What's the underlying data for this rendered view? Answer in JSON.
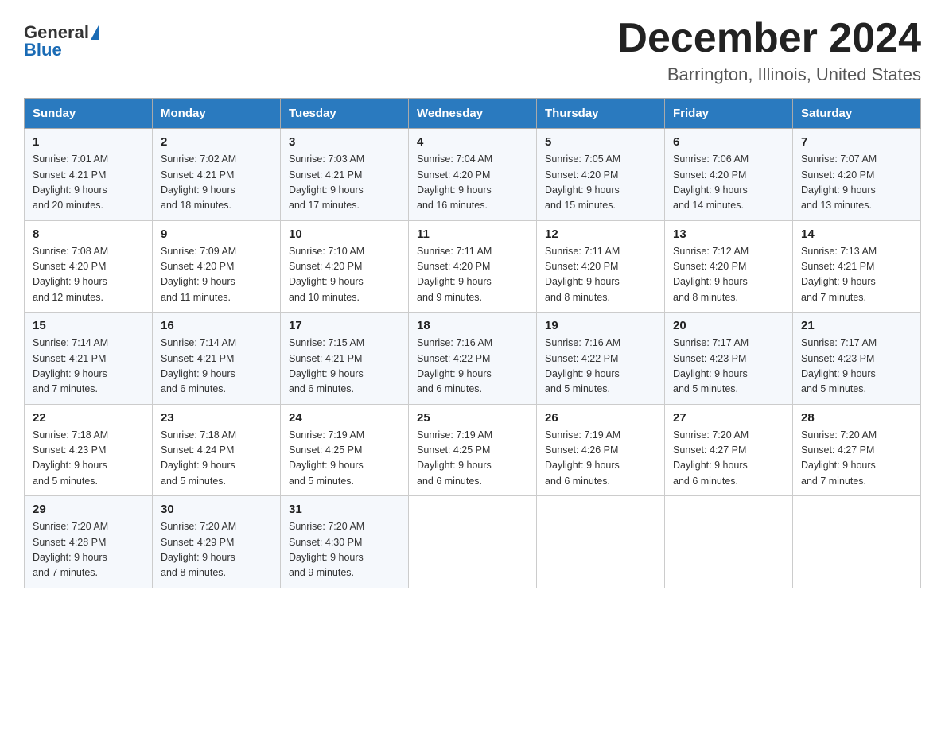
{
  "logo": {
    "general": "General",
    "blue": "Blue"
  },
  "title": "December 2024",
  "location": "Barrington, Illinois, United States",
  "days_of_week": [
    "Sunday",
    "Monday",
    "Tuesday",
    "Wednesday",
    "Thursday",
    "Friday",
    "Saturday"
  ],
  "weeks": [
    [
      {
        "day": "1",
        "sunrise": "7:01 AM",
        "sunset": "4:21 PM",
        "daylight": "9 hours and 20 minutes."
      },
      {
        "day": "2",
        "sunrise": "7:02 AM",
        "sunset": "4:21 PM",
        "daylight": "9 hours and 18 minutes."
      },
      {
        "day": "3",
        "sunrise": "7:03 AM",
        "sunset": "4:21 PM",
        "daylight": "9 hours and 17 minutes."
      },
      {
        "day": "4",
        "sunrise": "7:04 AM",
        "sunset": "4:20 PM",
        "daylight": "9 hours and 16 minutes."
      },
      {
        "day": "5",
        "sunrise": "7:05 AM",
        "sunset": "4:20 PM",
        "daylight": "9 hours and 15 minutes."
      },
      {
        "day": "6",
        "sunrise": "7:06 AM",
        "sunset": "4:20 PM",
        "daylight": "9 hours and 14 minutes."
      },
      {
        "day": "7",
        "sunrise": "7:07 AM",
        "sunset": "4:20 PM",
        "daylight": "9 hours and 13 minutes."
      }
    ],
    [
      {
        "day": "8",
        "sunrise": "7:08 AM",
        "sunset": "4:20 PM",
        "daylight": "9 hours and 12 minutes."
      },
      {
        "day": "9",
        "sunrise": "7:09 AM",
        "sunset": "4:20 PM",
        "daylight": "9 hours and 11 minutes."
      },
      {
        "day": "10",
        "sunrise": "7:10 AM",
        "sunset": "4:20 PM",
        "daylight": "9 hours and 10 minutes."
      },
      {
        "day": "11",
        "sunrise": "7:11 AM",
        "sunset": "4:20 PM",
        "daylight": "9 hours and 9 minutes."
      },
      {
        "day": "12",
        "sunrise": "7:11 AM",
        "sunset": "4:20 PM",
        "daylight": "9 hours and 8 minutes."
      },
      {
        "day": "13",
        "sunrise": "7:12 AM",
        "sunset": "4:20 PM",
        "daylight": "9 hours and 8 minutes."
      },
      {
        "day": "14",
        "sunrise": "7:13 AM",
        "sunset": "4:21 PM",
        "daylight": "9 hours and 7 minutes."
      }
    ],
    [
      {
        "day": "15",
        "sunrise": "7:14 AM",
        "sunset": "4:21 PM",
        "daylight": "9 hours and 7 minutes."
      },
      {
        "day": "16",
        "sunrise": "7:14 AM",
        "sunset": "4:21 PM",
        "daylight": "9 hours and 6 minutes."
      },
      {
        "day": "17",
        "sunrise": "7:15 AM",
        "sunset": "4:21 PM",
        "daylight": "9 hours and 6 minutes."
      },
      {
        "day": "18",
        "sunrise": "7:16 AM",
        "sunset": "4:22 PM",
        "daylight": "9 hours and 6 minutes."
      },
      {
        "day": "19",
        "sunrise": "7:16 AM",
        "sunset": "4:22 PM",
        "daylight": "9 hours and 5 minutes."
      },
      {
        "day": "20",
        "sunrise": "7:17 AM",
        "sunset": "4:23 PM",
        "daylight": "9 hours and 5 minutes."
      },
      {
        "day": "21",
        "sunrise": "7:17 AM",
        "sunset": "4:23 PM",
        "daylight": "9 hours and 5 minutes."
      }
    ],
    [
      {
        "day": "22",
        "sunrise": "7:18 AM",
        "sunset": "4:23 PM",
        "daylight": "9 hours and 5 minutes."
      },
      {
        "day": "23",
        "sunrise": "7:18 AM",
        "sunset": "4:24 PM",
        "daylight": "9 hours and 5 minutes."
      },
      {
        "day": "24",
        "sunrise": "7:19 AM",
        "sunset": "4:25 PM",
        "daylight": "9 hours and 5 minutes."
      },
      {
        "day": "25",
        "sunrise": "7:19 AM",
        "sunset": "4:25 PM",
        "daylight": "9 hours and 6 minutes."
      },
      {
        "day": "26",
        "sunrise": "7:19 AM",
        "sunset": "4:26 PM",
        "daylight": "9 hours and 6 minutes."
      },
      {
        "day": "27",
        "sunrise": "7:20 AM",
        "sunset": "4:27 PM",
        "daylight": "9 hours and 6 minutes."
      },
      {
        "day": "28",
        "sunrise": "7:20 AM",
        "sunset": "4:27 PM",
        "daylight": "9 hours and 7 minutes."
      }
    ],
    [
      {
        "day": "29",
        "sunrise": "7:20 AM",
        "sunset": "4:28 PM",
        "daylight": "9 hours and 7 minutes."
      },
      {
        "day": "30",
        "sunrise": "7:20 AM",
        "sunset": "4:29 PM",
        "daylight": "9 hours and 8 minutes."
      },
      {
        "day": "31",
        "sunrise": "7:20 AM",
        "sunset": "4:30 PM",
        "daylight": "9 hours and 9 minutes."
      },
      null,
      null,
      null,
      null
    ]
  ]
}
